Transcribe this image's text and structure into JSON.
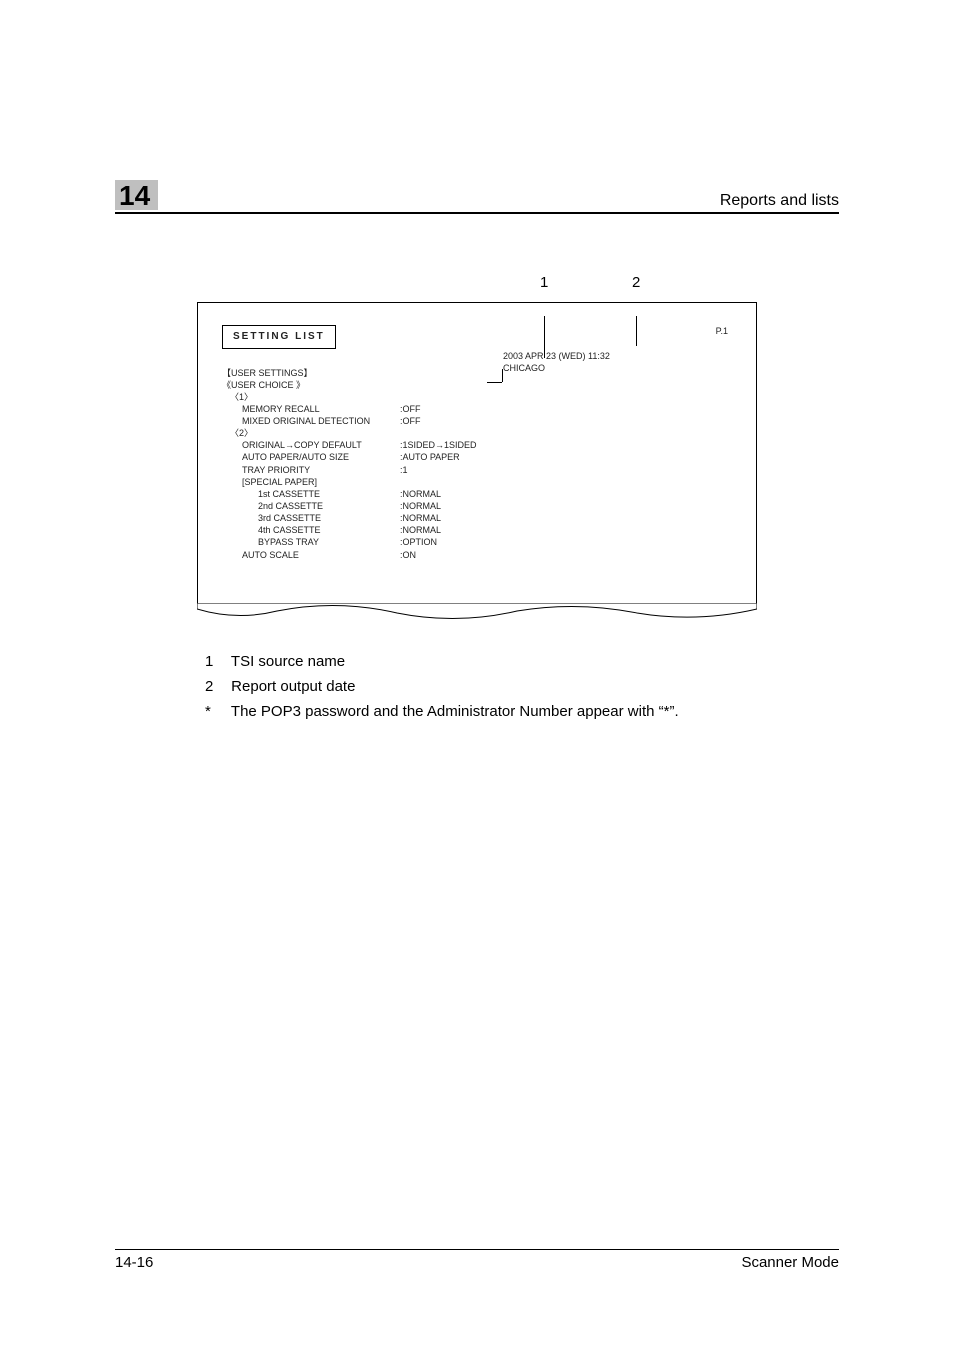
{
  "header": {
    "chapter": "14",
    "section": "Reports and lists"
  },
  "figure": {
    "callout1": "1",
    "callout2": "2",
    "page_num": "P.1",
    "title": "SETTING LIST",
    "datetime": "2003 APR 23 (WED) 11:32",
    "source": "CHICAGO",
    "h_user_settings": "【USER SETTINGS】",
    "h_user_choice": "《USER CHOICE 》",
    "g1": "〈1〉",
    "r1a_l": "MEMORY RECALL",
    "r1a_v": ":OFF",
    "r1b_l": "MIXED ORIGINAL DETECTION",
    "r1b_v": ":OFF",
    "g2": "〈2〉",
    "r2a_l": "ORIGINAL→COPY DEFAULT",
    "r2a_v": ":1SIDED→1SIDED",
    "r2b_l": "AUTO PAPER/AUTO SIZE",
    "r2b_v": ":AUTO PAPER",
    "r2c_l": "TRAY PRIORITY",
    "r2c_v": ":1",
    "r2d_l": "[SPECIAL PAPER]",
    "r2e_l": "1st CASSETTE",
    "r2e_v": ":NORMAL",
    "r2f_l": "2nd CASSETTE",
    "r2f_v": ":NORMAL",
    "r2g_l": "3rd CASSETTE",
    "r2g_v": ":NORMAL",
    "r2h_l": "4th CASSETTE",
    "r2h_v": ":NORMAL",
    "r2i_l": "BYPASS TRAY",
    "r2i_v": ":OPTION",
    "r2j_l": "AUTO SCALE",
    "r2j_v": ":ON"
  },
  "legend": {
    "n1": "1",
    "t1": "TSI source name",
    "n2": "2",
    "t2": "Report output date",
    "nstar": "*",
    "tstar": "The POP3 password and the Administrator Number appear with “*”."
  },
  "footer": {
    "left": "14-16",
    "right": "Scanner Mode"
  }
}
